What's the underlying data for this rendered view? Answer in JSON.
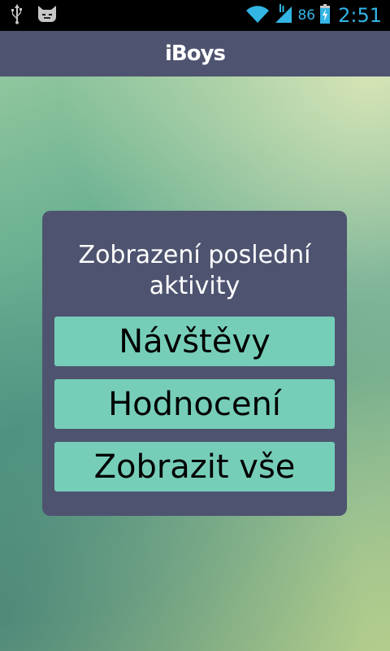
{
  "status_bar": {
    "battery_percent": "86",
    "time": "2:51",
    "icons": [
      "usb-icon",
      "cyanogen-icon",
      "wifi-icon",
      "signal-icon",
      "battery-icon"
    ],
    "accent_color": "#33b5e5"
  },
  "app_bar": {
    "title": "iBoys",
    "background": "#4e5470"
  },
  "dialog": {
    "title": "Zobrazení poslední aktivity",
    "background": "#4e5470",
    "options": [
      {
        "label": "Návštěvy"
      },
      {
        "label": "Hodnocení"
      },
      {
        "label": "Zobrazit vše"
      }
    ],
    "button_color": "#76ceb9"
  }
}
